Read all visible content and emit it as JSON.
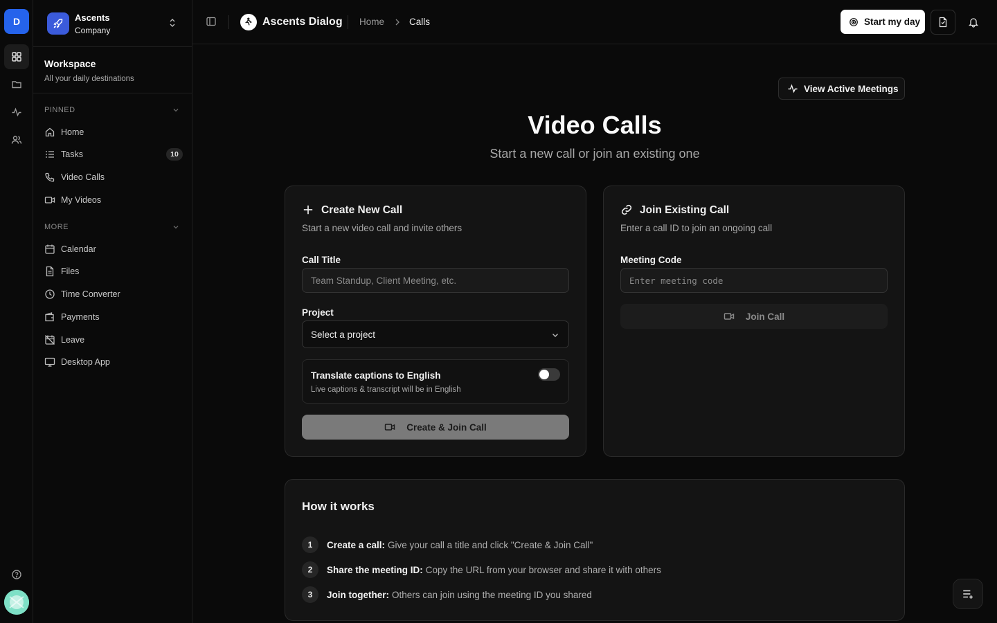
{
  "rail": {
    "logo_letter": "D",
    "items": [
      "grid-icon",
      "folder-icon",
      "activity-icon",
      "users-icon"
    ],
    "help_icon": "help-circle-icon"
  },
  "company": {
    "name": "Ascents",
    "sub": "Company"
  },
  "workspace": {
    "title": "Workspace",
    "subtitle": "All your daily destinations"
  },
  "pinned": {
    "header": "PINNED",
    "items": [
      {
        "label": "Home",
        "icon": "home-icon"
      },
      {
        "label": "Tasks",
        "icon": "tasks-icon",
        "badge": "10"
      },
      {
        "label": "Video Calls",
        "icon": "phone-icon"
      },
      {
        "label": "My Videos",
        "icon": "video-icon"
      }
    ]
  },
  "more": {
    "header": "MORE",
    "items": [
      {
        "label": "Calendar",
        "icon": "calendar-icon"
      },
      {
        "label": "Files",
        "icon": "file-icon"
      },
      {
        "label": "Time Converter",
        "icon": "clock-icon"
      },
      {
        "label": "Payments",
        "icon": "wallet-icon"
      },
      {
        "label": "Leave",
        "icon": "calendar-off-icon"
      },
      {
        "label": "Desktop App",
        "icon": "monitor-icon"
      }
    ]
  },
  "topbar": {
    "app_name": "Ascents Dialog",
    "breadcrumb": [
      "Home",
      "Calls"
    ],
    "start_day_label": "Start my day"
  },
  "page": {
    "view_active_label": "View Active Meetings",
    "title": "Video Calls",
    "subtitle": "Start a new call or join an existing one"
  },
  "create": {
    "title": "Create New Call",
    "desc": "Start a new video call and invite others",
    "call_title_label": "Call Title",
    "call_title_placeholder": "Team Standup, Client Meeting, etc.",
    "project_label": "Project",
    "project_value": "Select a project",
    "translate_title": "Translate captions to English",
    "translate_desc": "Live captions & transcript will be in English",
    "translate_on": false,
    "button_label": "Create & Join Call"
  },
  "join": {
    "title": "Join Existing Call",
    "desc": "Enter a call ID to join an ongoing call",
    "code_label": "Meeting Code",
    "code_placeholder": "Enter meeting code",
    "button_label": "Join Call"
  },
  "how": {
    "title": "How it works",
    "steps": [
      {
        "num": "1",
        "bold": "Create a call:",
        "text": "Give your call a title and click \"Create & Join Call\""
      },
      {
        "num": "2",
        "bold": "Share the meeting ID:",
        "text": "Copy the URL from your browser and share it with others"
      },
      {
        "num": "3",
        "bold": "Join together:",
        "text": "Others can join using the meeting ID you shared"
      }
    ]
  },
  "colors": {
    "accent": "#2563eb",
    "company_logo": "#3b5bdb",
    "background": "#0a0a0a",
    "card": "#141414"
  }
}
